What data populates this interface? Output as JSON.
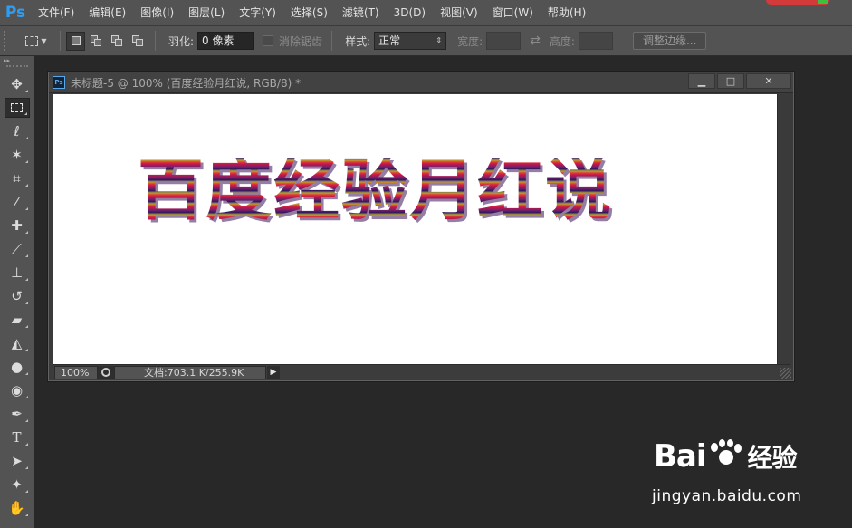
{
  "menubar": {
    "logo": "Ps",
    "items": [
      "文件(F)",
      "编辑(E)",
      "图像(I)",
      "图层(L)",
      "文字(Y)",
      "选择(S)",
      "滤镜(T)",
      "3D(D)",
      "视图(V)",
      "窗口(W)",
      "帮助(H)"
    ]
  },
  "options": {
    "feather_label": "羽化:",
    "feather_value": "0 像素",
    "antialias_label": "消除锯齿",
    "style_label": "样式:",
    "style_value": "正常",
    "width_label": "宽度:",
    "height_label": "高度:",
    "refine_edge_button": "调整边缘..."
  },
  "toolbar": {
    "collapse_glyph": "▸▸",
    "tools": [
      {
        "name": "move-tool",
        "glyph": "✥"
      },
      {
        "name": "rect-marquee-tool",
        "glyph": ""
      },
      {
        "name": "lasso-tool",
        "glyph": "ℓ"
      },
      {
        "name": "magic-wand-tool",
        "glyph": "✶"
      },
      {
        "name": "crop-tool",
        "glyph": "⌗"
      },
      {
        "name": "eyedropper-tool",
        "glyph": "⁄"
      },
      {
        "name": "healing-brush-tool",
        "glyph": "✚"
      },
      {
        "name": "brush-tool",
        "glyph": "⟋"
      },
      {
        "name": "clone-stamp-tool",
        "glyph": "⊥"
      },
      {
        "name": "history-brush-tool",
        "glyph": "↺"
      },
      {
        "name": "eraser-tool",
        "glyph": "▰"
      },
      {
        "name": "paint-bucket-tool",
        "glyph": "◭"
      },
      {
        "name": "blur-tool",
        "glyph": "●"
      },
      {
        "name": "dodge-tool",
        "glyph": "◉"
      },
      {
        "name": "pen-tool",
        "glyph": "✒"
      },
      {
        "name": "type-tool",
        "glyph": "T"
      },
      {
        "name": "path-selection-tool",
        "glyph": "➤"
      },
      {
        "name": "custom-shape-tool",
        "glyph": "✦"
      },
      {
        "name": "hand-tool",
        "glyph": "✋"
      }
    ]
  },
  "document": {
    "title": "未标题-5 @ 100% (百度经验月红说, RGB/8) *",
    "canvas_text": "百度经验月红说",
    "zoom": "100%",
    "doc_info": "文档:703.1 K/255.9K",
    "minimize_glyph": "▁",
    "maximize_glyph": "□",
    "close_glyph": "✕"
  },
  "watermark": {
    "brand_left": "Bai",
    "brand_right": "经验",
    "url": "jingyan.baidu.com"
  },
  "colors": {
    "accent": "#2c9ef7",
    "panel": "#535353",
    "workspace": "#282828"
  }
}
